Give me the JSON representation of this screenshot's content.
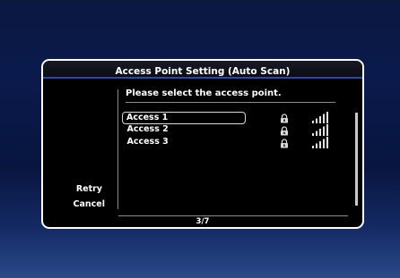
{
  "dialog": {
    "title": "Access Point Setting (Auto Scan)",
    "prompt": "Please select the access point.",
    "access_points": [
      {
        "name": "Access 1",
        "secured": true,
        "signal_bars": 5,
        "selected": true
      },
      {
        "name": "Access 2",
        "secured": true,
        "signal_bars": 5,
        "selected": false
      },
      {
        "name": "Access 3",
        "secured": true,
        "signal_bars": 5,
        "selected": false
      }
    ],
    "side_buttons": {
      "retry": "Retry",
      "cancel": "Cancel"
    },
    "page_indicator": "3/7"
  },
  "colors": {
    "frame_border": "#ffffff",
    "title_underline": "#2a4aa8",
    "background_top": "#0b1840",
    "background_bottom": "#2a4a88"
  },
  "icons": [
    "lock-icon",
    "signal-strength-icon"
  ]
}
